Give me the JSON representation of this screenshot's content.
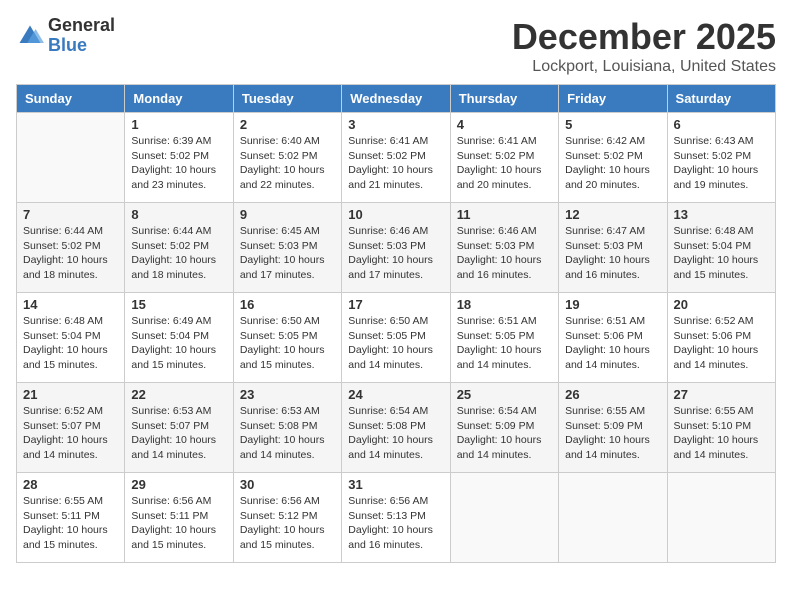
{
  "header": {
    "logo_general": "General",
    "logo_blue": "Blue",
    "month_title": "December 2025",
    "location": "Lockport, Louisiana, United States"
  },
  "days_of_week": [
    "Sunday",
    "Monday",
    "Tuesday",
    "Wednesday",
    "Thursday",
    "Friday",
    "Saturday"
  ],
  "weeks": [
    [
      {
        "day": "",
        "info": ""
      },
      {
        "day": "1",
        "info": "Sunrise: 6:39 AM\nSunset: 5:02 PM\nDaylight: 10 hours and 23 minutes."
      },
      {
        "day": "2",
        "info": "Sunrise: 6:40 AM\nSunset: 5:02 PM\nDaylight: 10 hours and 22 minutes."
      },
      {
        "day": "3",
        "info": "Sunrise: 6:41 AM\nSunset: 5:02 PM\nDaylight: 10 hours and 21 minutes."
      },
      {
        "day": "4",
        "info": "Sunrise: 6:41 AM\nSunset: 5:02 PM\nDaylight: 10 hours and 20 minutes."
      },
      {
        "day": "5",
        "info": "Sunrise: 6:42 AM\nSunset: 5:02 PM\nDaylight: 10 hours and 20 minutes."
      },
      {
        "day": "6",
        "info": "Sunrise: 6:43 AM\nSunset: 5:02 PM\nDaylight: 10 hours and 19 minutes."
      }
    ],
    [
      {
        "day": "7",
        "info": "Sunrise: 6:44 AM\nSunset: 5:02 PM\nDaylight: 10 hours and 18 minutes."
      },
      {
        "day": "8",
        "info": "Sunrise: 6:44 AM\nSunset: 5:02 PM\nDaylight: 10 hours and 18 minutes."
      },
      {
        "day": "9",
        "info": "Sunrise: 6:45 AM\nSunset: 5:03 PM\nDaylight: 10 hours and 17 minutes."
      },
      {
        "day": "10",
        "info": "Sunrise: 6:46 AM\nSunset: 5:03 PM\nDaylight: 10 hours and 17 minutes."
      },
      {
        "day": "11",
        "info": "Sunrise: 6:46 AM\nSunset: 5:03 PM\nDaylight: 10 hours and 16 minutes."
      },
      {
        "day": "12",
        "info": "Sunrise: 6:47 AM\nSunset: 5:03 PM\nDaylight: 10 hours and 16 minutes."
      },
      {
        "day": "13",
        "info": "Sunrise: 6:48 AM\nSunset: 5:04 PM\nDaylight: 10 hours and 15 minutes."
      }
    ],
    [
      {
        "day": "14",
        "info": "Sunrise: 6:48 AM\nSunset: 5:04 PM\nDaylight: 10 hours and 15 minutes."
      },
      {
        "day": "15",
        "info": "Sunrise: 6:49 AM\nSunset: 5:04 PM\nDaylight: 10 hours and 15 minutes."
      },
      {
        "day": "16",
        "info": "Sunrise: 6:50 AM\nSunset: 5:05 PM\nDaylight: 10 hours and 15 minutes."
      },
      {
        "day": "17",
        "info": "Sunrise: 6:50 AM\nSunset: 5:05 PM\nDaylight: 10 hours and 14 minutes."
      },
      {
        "day": "18",
        "info": "Sunrise: 6:51 AM\nSunset: 5:05 PM\nDaylight: 10 hours and 14 minutes."
      },
      {
        "day": "19",
        "info": "Sunrise: 6:51 AM\nSunset: 5:06 PM\nDaylight: 10 hours and 14 minutes."
      },
      {
        "day": "20",
        "info": "Sunrise: 6:52 AM\nSunset: 5:06 PM\nDaylight: 10 hours and 14 minutes."
      }
    ],
    [
      {
        "day": "21",
        "info": "Sunrise: 6:52 AM\nSunset: 5:07 PM\nDaylight: 10 hours and 14 minutes."
      },
      {
        "day": "22",
        "info": "Sunrise: 6:53 AM\nSunset: 5:07 PM\nDaylight: 10 hours and 14 minutes."
      },
      {
        "day": "23",
        "info": "Sunrise: 6:53 AM\nSunset: 5:08 PM\nDaylight: 10 hours and 14 minutes."
      },
      {
        "day": "24",
        "info": "Sunrise: 6:54 AM\nSunset: 5:08 PM\nDaylight: 10 hours and 14 minutes."
      },
      {
        "day": "25",
        "info": "Sunrise: 6:54 AM\nSunset: 5:09 PM\nDaylight: 10 hours and 14 minutes."
      },
      {
        "day": "26",
        "info": "Sunrise: 6:55 AM\nSunset: 5:09 PM\nDaylight: 10 hours and 14 minutes."
      },
      {
        "day": "27",
        "info": "Sunrise: 6:55 AM\nSunset: 5:10 PM\nDaylight: 10 hours and 14 minutes."
      }
    ],
    [
      {
        "day": "28",
        "info": "Sunrise: 6:55 AM\nSunset: 5:11 PM\nDaylight: 10 hours and 15 minutes."
      },
      {
        "day": "29",
        "info": "Sunrise: 6:56 AM\nSunset: 5:11 PM\nDaylight: 10 hours and 15 minutes."
      },
      {
        "day": "30",
        "info": "Sunrise: 6:56 AM\nSunset: 5:12 PM\nDaylight: 10 hours and 15 minutes."
      },
      {
        "day": "31",
        "info": "Sunrise: 6:56 AM\nSunset: 5:13 PM\nDaylight: 10 hours and 16 minutes."
      },
      {
        "day": "",
        "info": ""
      },
      {
        "day": "",
        "info": ""
      },
      {
        "day": "",
        "info": ""
      }
    ]
  ]
}
